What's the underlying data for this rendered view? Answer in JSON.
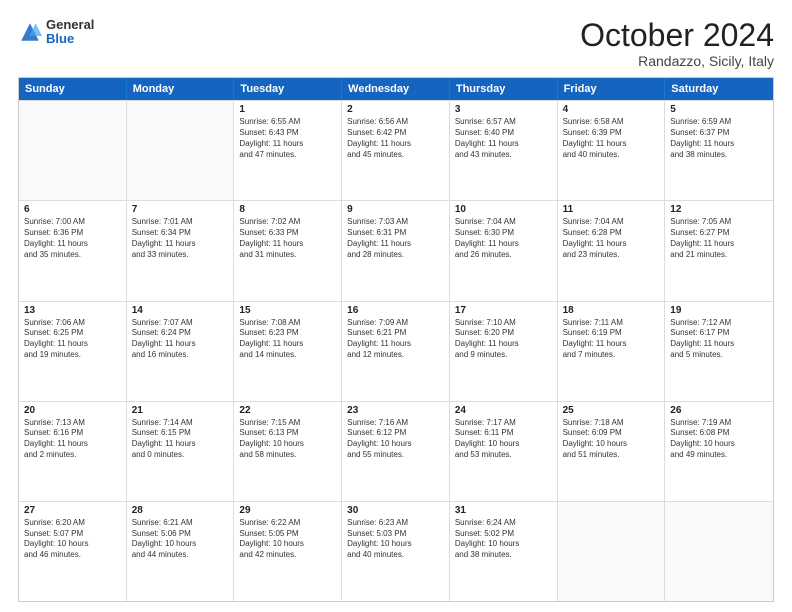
{
  "header": {
    "logo_general": "General",
    "logo_blue": "Blue",
    "month_title": "October 2024",
    "location": "Randazzo, Sicily, Italy"
  },
  "days_of_week": [
    "Sunday",
    "Monday",
    "Tuesday",
    "Wednesday",
    "Thursday",
    "Friday",
    "Saturday"
  ],
  "weeks": [
    [
      {
        "day": "",
        "detail": ""
      },
      {
        "day": "",
        "detail": ""
      },
      {
        "day": "1",
        "detail": "Sunrise: 6:55 AM\nSunset: 6:43 PM\nDaylight: 11 hours\nand 47 minutes."
      },
      {
        "day": "2",
        "detail": "Sunrise: 6:56 AM\nSunset: 6:42 PM\nDaylight: 11 hours\nand 45 minutes."
      },
      {
        "day": "3",
        "detail": "Sunrise: 6:57 AM\nSunset: 6:40 PM\nDaylight: 11 hours\nand 43 minutes."
      },
      {
        "day": "4",
        "detail": "Sunrise: 6:58 AM\nSunset: 6:39 PM\nDaylight: 11 hours\nand 40 minutes."
      },
      {
        "day": "5",
        "detail": "Sunrise: 6:59 AM\nSunset: 6:37 PM\nDaylight: 11 hours\nand 38 minutes."
      }
    ],
    [
      {
        "day": "6",
        "detail": "Sunrise: 7:00 AM\nSunset: 6:36 PM\nDaylight: 11 hours\nand 35 minutes."
      },
      {
        "day": "7",
        "detail": "Sunrise: 7:01 AM\nSunset: 6:34 PM\nDaylight: 11 hours\nand 33 minutes."
      },
      {
        "day": "8",
        "detail": "Sunrise: 7:02 AM\nSunset: 6:33 PM\nDaylight: 11 hours\nand 31 minutes."
      },
      {
        "day": "9",
        "detail": "Sunrise: 7:03 AM\nSunset: 6:31 PM\nDaylight: 11 hours\nand 28 minutes."
      },
      {
        "day": "10",
        "detail": "Sunrise: 7:04 AM\nSunset: 6:30 PM\nDaylight: 11 hours\nand 26 minutes."
      },
      {
        "day": "11",
        "detail": "Sunrise: 7:04 AM\nSunset: 6:28 PM\nDaylight: 11 hours\nand 23 minutes."
      },
      {
        "day": "12",
        "detail": "Sunrise: 7:05 AM\nSunset: 6:27 PM\nDaylight: 11 hours\nand 21 minutes."
      }
    ],
    [
      {
        "day": "13",
        "detail": "Sunrise: 7:06 AM\nSunset: 6:25 PM\nDaylight: 11 hours\nand 19 minutes."
      },
      {
        "day": "14",
        "detail": "Sunrise: 7:07 AM\nSunset: 6:24 PM\nDaylight: 11 hours\nand 16 minutes."
      },
      {
        "day": "15",
        "detail": "Sunrise: 7:08 AM\nSunset: 6:23 PM\nDaylight: 11 hours\nand 14 minutes."
      },
      {
        "day": "16",
        "detail": "Sunrise: 7:09 AM\nSunset: 6:21 PM\nDaylight: 11 hours\nand 12 minutes."
      },
      {
        "day": "17",
        "detail": "Sunrise: 7:10 AM\nSunset: 6:20 PM\nDaylight: 11 hours\nand 9 minutes."
      },
      {
        "day": "18",
        "detail": "Sunrise: 7:11 AM\nSunset: 6:19 PM\nDaylight: 11 hours\nand 7 minutes."
      },
      {
        "day": "19",
        "detail": "Sunrise: 7:12 AM\nSunset: 6:17 PM\nDaylight: 11 hours\nand 5 minutes."
      }
    ],
    [
      {
        "day": "20",
        "detail": "Sunrise: 7:13 AM\nSunset: 6:16 PM\nDaylight: 11 hours\nand 2 minutes."
      },
      {
        "day": "21",
        "detail": "Sunrise: 7:14 AM\nSunset: 6:15 PM\nDaylight: 11 hours\nand 0 minutes."
      },
      {
        "day": "22",
        "detail": "Sunrise: 7:15 AM\nSunset: 6:13 PM\nDaylight: 10 hours\nand 58 minutes."
      },
      {
        "day": "23",
        "detail": "Sunrise: 7:16 AM\nSunset: 6:12 PM\nDaylight: 10 hours\nand 55 minutes."
      },
      {
        "day": "24",
        "detail": "Sunrise: 7:17 AM\nSunset: 6:11 PM\nDaylight: 10 hours\nand 53 minutes."
      },
      {
        "day": "25",
        "detail": "Sunrise: 7:18 AM\nSunset: 6:09 PM\nDaylight: 10 hours\nand 51 minutes."
      },
      {
        "day": "26",
        "detail": "Sunrise: 7:19 AM\nSunset: 6:08 PM\nDaylight: 10 hours\nand 49 minutes."
      }
    ],
    [
      {
        "day": "27",
        "detail": "Sunrise: 6:20 AM\nSunset: 5:07 PM\nDaylight: 10 hours\nand 46 minutes."
      },
      {
        "day": "28",
        "detail": "Sunrise: 6:21 AM\nSunset: 5:06 PM\nDaylight: 10 hours\nand 44 minutes."
      },
      {
        "day": "29",
        "detail": "Sunrise: 6:22 AM\nSunset: 5:05 PM\nDaylight: 10 hours\nand 42 minutes."
      },
      {
        "day": "30",
        "detail": "Sunrise: 6:23 AM\nSunset: 5:03 PM\nDaylight: 10 hours\nand 40 minutes."
      },
      {
        "day": "31",
        "detail": "Sunrise: 6:24 AM\nSunset: 5:02 PM\nDaylight: 10 hours\nand 38 minutes."
      },
      {
        "day": "",
        "detail": ""
      },
      {
        "day": "",
        "detail": ""
      }
    ]
  ]
}
